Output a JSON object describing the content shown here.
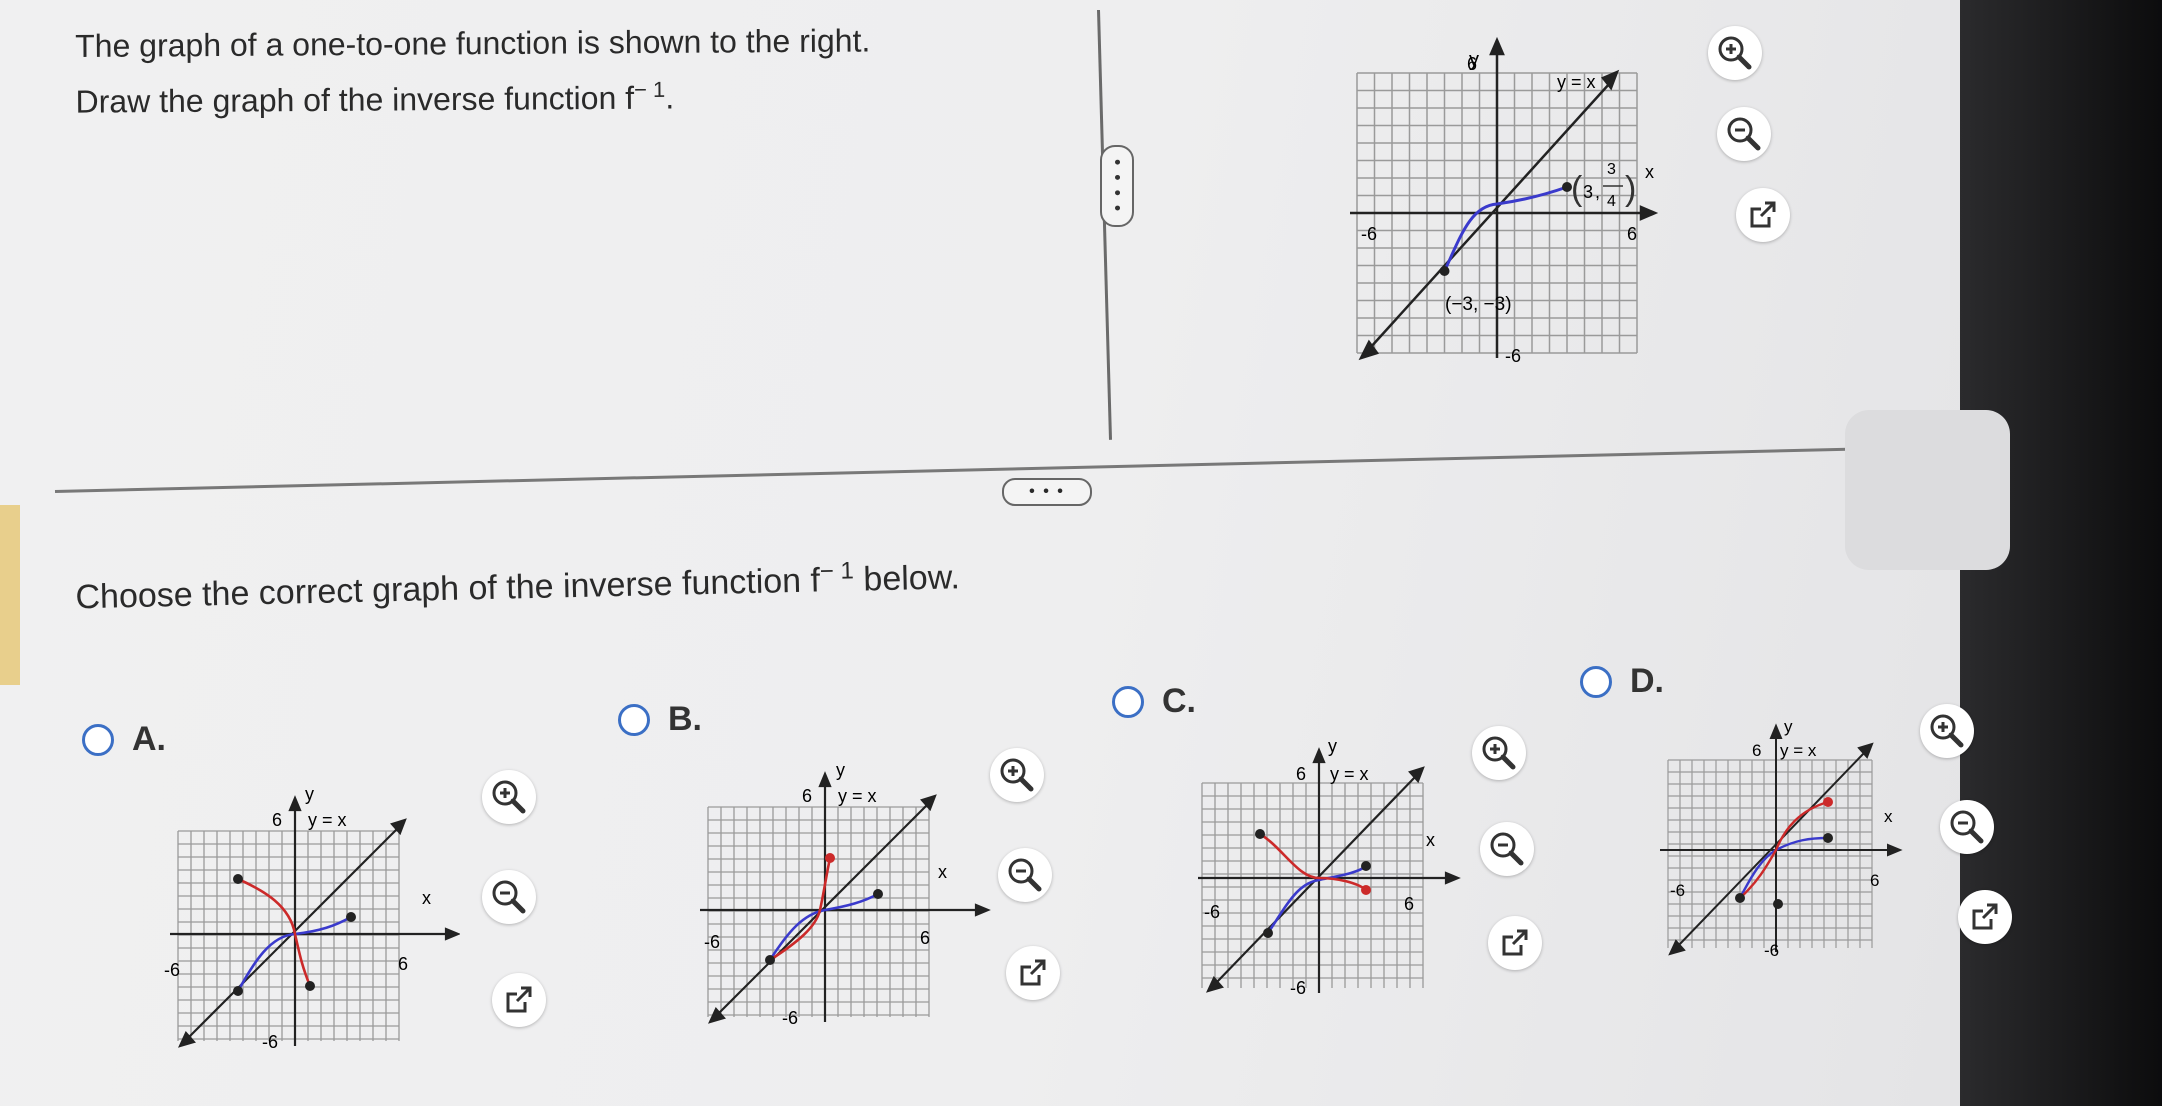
{
  "question": {
    "line1": "The graph of a one-to-one function is shown to the right.",
    "line2_pre": "Draw the graph of the inverse function f",
    "line2_sup": "− 1",
    "line2_post": "."
  },
  "divider_handle_label": "• • • •",
  "section_handle_label": "• • •",
  "prompt": {
    "pre": "Choose the correct graph of the inverse function f",
    "sup": "− 1",
    "post": " below."
  },
  "main_graph": {
    "ylabel": "y",
    "xlabel": "x",
    "line_label": "y = x",
    "tick_pos": "6",
    "tick_neg": "-6",
    "point1_label": "(−3, −3)",
    "point2_label": "(3, 3/4)",
    "frac_num": "3",
    "frac_den": "4",
    "point2_x": "3",
    "colors": {
      "function": "#3a3acc",
      "line": "#222222",
      "grid": "#9a9a9a"
    }
  },
  "options": [
    {
      "letter": "A.",
      "ylabel": "y",
      "xlabel": "x",
      "line_label": "y = x",
      "tick_pos": "6",
      "tick_neg": "-6"
    },
    {
      "letter": "B.",
      "ylabel": "y",
      "xlabel": "x",
      "line_label": "y = x",
      "tick_pos": "6",
      "tick_neg": "-6"
    },
    {
      "letter": "C.",
      "ylabel": "y",
      "xlabel": "x",
      "line_label": "y = x",
      "tick_pos": "6",
      "tick_neg": "-6"
    },
    {
      "letter": "D.",
      "ylabel": "y",
      "xlabel": "x",
      "line_label": "y = x",
      "tick_pos": "6",
      "tick_neg": "-6"
    }
  ],
  "tools": {
    "zoom_in": "zoom-in-icon",
    "zoom_out": "zoom-out-icon",
    "popout": "popout-icon"
  },
  "colors": {
    "radio": "#3b6fc5",
    "inverse": "#cc2a2a",
    "function": "#3a3acc"
  }
}
